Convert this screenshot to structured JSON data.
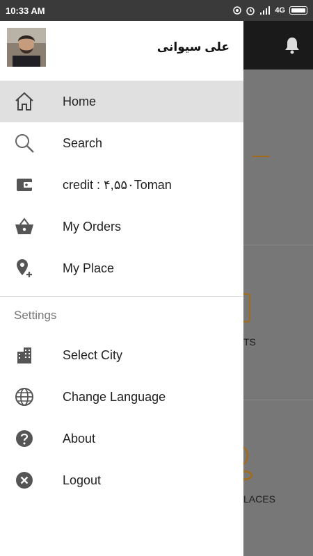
{
  "status_bar": {
    "time": "10:33 AM",
    "network": "4G"
  },
  "user": {
    "name": "علی سیوانی"
  },
  "menu": {
    "items": [
      {
        "label": "Home",
        "icon": "home-icon",
        "active": true
      },
      {
        "label": "Search",
        "icon": "search-icon"
      },
      {
        "label": "credit : ۴,۵۵۰Toman",
        "icon": "wallet-icon"
      },
      {
        "label": "My Orders",
        "icon": "basket-icon"
      },
      {
        "label": "My Place",
        "icon": "add-location-icon"
      }
    ],
    "settings_title": "Settings",
    "settings_items": [
      {
        "label": "Select City",
        "icon": "city-icon"
      },
      {
        "label": "Change Language",
        "icon": "globe-icon"
      },
      {
        "label": "About",
        "icon": "help-icon"
      },
      {
        "label": "Logout",
        "icon": "close-circle-icon"
      }
    ]
  },
  "background": {
    "label_events": "TS",
    "label_places": "LACES"
  },
  "colors": {
    "accent": "#a36a18",
    "active_bg": "#e0e0e0",
    "icon": "#555555"
  }
}
